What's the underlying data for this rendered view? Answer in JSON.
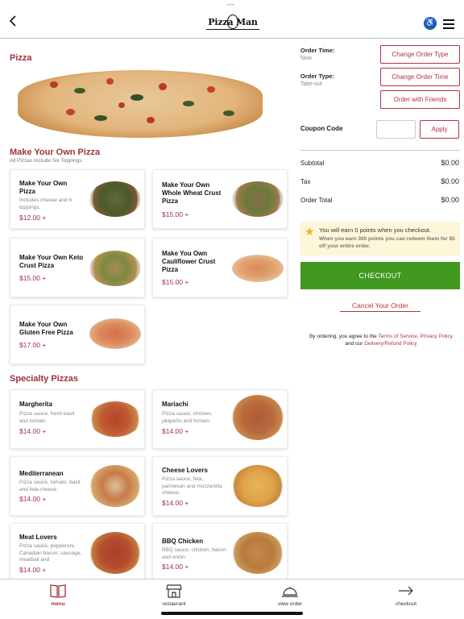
{
  "header": {
    "logo_text": "Pizza Man",
    "colors": {
      "accent": "#a0323c",
      "checkout": "#42991f",
      "accessibility": "#1e5fa0"
    }
  },
  "menu": {
    "category_title": "Pizza",
    "sections": [
      {
        "title": "Make Your Own Pizza",
        "subtitle": "All Pizzas Include Six Toppings.",
        "items": [
          {
            "name": "Make Your Own Pizza",
            "desc": "Includes cheese and 6 toppings.",
            "price": "$12.00 +"
          },
          {
            "name": "Make Your Own Whole Wheat Crust Pizza",
            "desc": "",
            "price": "$15.00 +"
          },
          {
            "name": "Make Your Own Keto Crust Pizza",
            "desc": "",
            "price": "$15.00 +"
          },
          {
            "name": "Make You Own Cauliflower Crust Pizza",
            "desc": "",
            "price": "$15.00 +"
          },
          {
            "name": "Make Your Own Gluten Free Pizza",
            "desc": "",
            "price": "$17.00 +"
          }
        ]
      },
      {
        "title": "Specialty Pizzas",
        "subtitle": "",
        "items": [
          {
            "name": "Margherita",
            "desc": "Pizza sauce, fresh basil and tomato.",
            "price": "$14.00 +"
          },
          {
            "name": "Mariachi",
            "desc": "Pizza sauce, chicken, jalapeño and tomato.",
            "price": "$14.00 +"
          },
          {
            "name": "Mediterranean",
            "desc": "Pizza sauce, tomato, basil and feta cheese.",
            "price": "$14.00 +"
          },
          {
            "name": "Cheese Lovers",
            "desc": "Pizza sauce, feta, parmesan and mozzarella cheese.",
            "price": "$14.00 +"
          },
          {
            "name": "Meat Lovers",
            "desc": "Pizza sauce, pepperoni, Canadian bacon, sausage, meatball and",
            "price": "$14.00 +"
          },
          {
            "name": "BBQ Chicken",
            "desc": "BBQ sauce, chicken, bacon and onion.",
            "price": "$14.00 +"
          }
        ]
      }
    ]
  },
  "order": {
    "order_time_label": "Order Time:",
    "order_time_value": "Now",
    "order_type_label": "Order Type:",
    "order_type_value": "Take-out",
    "change_order_type": "Change Order Type",
    "change_order_time": "Change Order Time",
    "order_with_friends": "Order with Friends",
    "coupon_label": "Coupon Code",
    "coupon_value": "",
    "apply": "Apply",
    "subtotal_label": "Subtotal",
    "subtotal_value": "$0.00",
    "tax_label": "Tax",
    "tax_value": "$0.00",
    "total_label": "Order Total",
    "total_value": "$0.00",
    "points_main": "You will earn 0 points when you checkout.",
    "points_sub": "When you earn 300 points you can redeem them for $5 off your entire order.",
    "checkout": "CHECKOUT",
    "cancel": "Cancel Your Order",
    "terms_prefix": "By ordering, you agree to the",
    "terms_link": "Terms of Service",
    "privacy_link": "Privacy Policy",
    "terms_mid": "and our",
    "refund_link": "Delivery/Refund Policy"
  },
  "nav": {
    "items": [
      {
        "label": "menu",
        "icon": "menu-book-icon",
        "active": true
      },
      {
        "label": "restaurant",
        "icon": "storefront-icon",
        "active": false
      },
      {
        "label": "view order",
        "icon": "cloche-icon",
        "active": false
      },
      {
        "label": "checkout",
        "icon": "arrow-right-icon",
        "active": false
      }
    ]
  }
}
